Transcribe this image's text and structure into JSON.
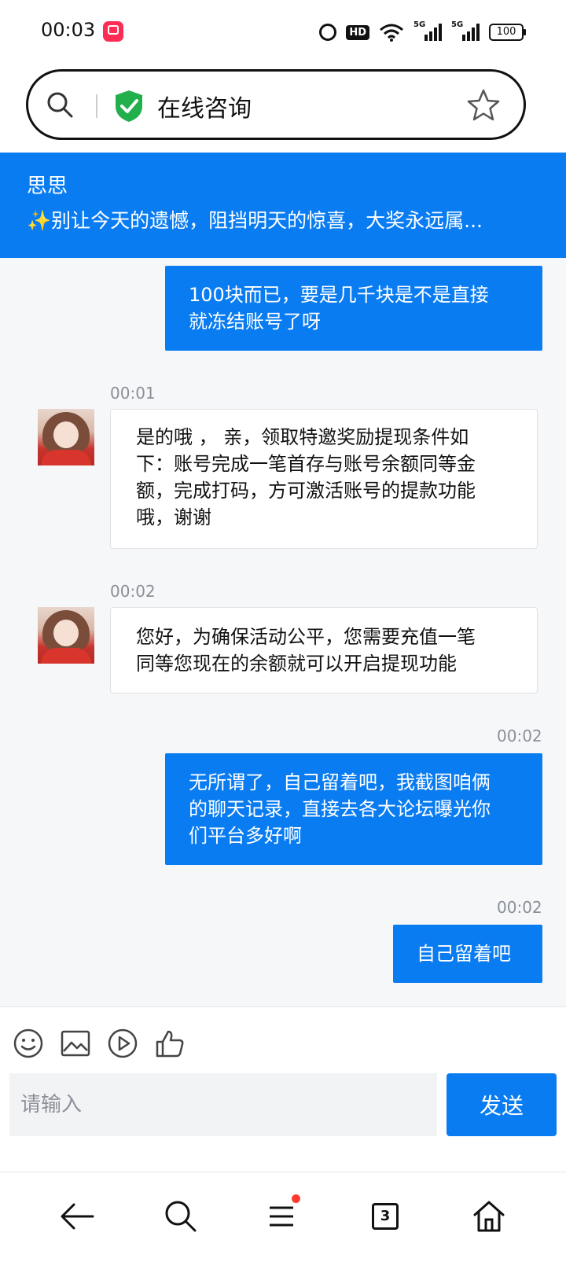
{
  "status_bar": {
    "time": "00:03",
    "network_1": "5G",
    "network_2": "5G",
    "battery": "100",
    "hd_label": "HD"
  },
  "address_bar": {
    "title": "在线咨询",
    "secure_icon": "shield-check-icon",
    "bookmark_icon": "star-icon"
  },
  "banner": {
    "name": "思思",
    "notice": "✨别让今天的遗憾，阻挡明天的惊喜，大奖永远属..."
  },
  "messages": [
    {
      "side": "out",
      "time": "",
      "text_lines": [
        "100块而已，要是几千块是不是直接",
        "就冻结账号了呀"
      ]
    },
    {
      "side": "in",
      "time": "00:01",
      "text_lines": [
        "是的哦 ， 亲，领取特邀奖励提现条件如",
        "下：账号完成一笔首存与账号余额同等金",
        "额，完成打码，方可激活账号的提款功能",
        "哦，谢谢"
      ]
    },
    {
      "side": "in",
      "time": "00:02",
      "text_lines": [
        "您好，为确保活动公平，您需要充值一笔",
        "同等您现在的余额就可以开启提现功能"
      ]
    },
    {
      "side": "out",
      "time": "00:02",
      "text_lines": [
        "无所谓了，自己留着吧，我截图咱俩",
        "的聊天记录，直接去各大论坛曝光你",
        "们平台多好啊"
      ]
    },
    {
      "side": "out",
      "time": "00:02",
      "text_lines": [
        "自己留着吧"
      ]
    }
  ],
  "composer": {
    "tools": [
      "emoji-icon",
      "image-icon",
      "video-play-icon",
      "thumbs-up-icon"
    ],
    "placeholder": "请输入",
    "send_label": "发送"
  },
  "bottom_nav": {
    "tabs_count": "3",
    "items": [
      "back-arrow-icon",
      "search-icon",
      "menu-icon",
      "tabs-icon",
      "home-icon"
    ]
  },
  "colors": {
    "accent": "#0a7cf2",
    "badge": "#ff3b30"
  }
}
